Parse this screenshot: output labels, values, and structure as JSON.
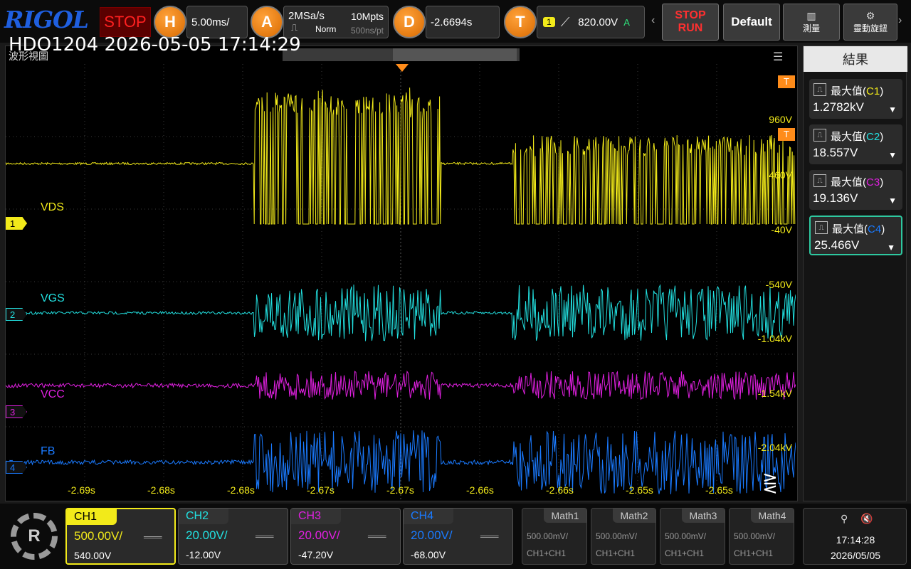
{
  "brand": "RIGOL",
  "run_state": "STOP",
  "horizontal": {
    "key": "H",
    "scale": "5.00ms/"
  },
  "acquire": {
    "key": "A",
    "rate": "2MSa/s",
    "depth": "10Mpts",
    "mode": "Norm",
    "res": "500ns/pt"
  },
  "delay": {
    "key": "D",
    "value": "-2.6694s"
  },
  "trigger": {
    "key": "T",
    "source": "1",
    "level": "820.00V",
    "mode": "A"
  },
  "buttons": {
    "stop_run_1": "STOP",
    "stop_run_2": "RUN",
    "default": "Default",
    "measure": "測量",
    "quick": "靈動旋鈕"
  },
  "overlay_text": "HDO1204 2026-05-05 17:14:29",
  "waveform_title": "波形視圖",
  "time_ticks": [
    "-2.69s",
    "-2.68s",
    "-2.68s",
    "-2.67s",
    "-2.67s",
    "-2.66s",
    "-2.66s",
    "-2.65s",
    "-2.65s"
  ],
  "volt_ticks": [
    "960V",
    "460V",
    "-40V",
    "-540V",
    "-1.04kV",
    "-1.54kV",
    "-2.04kV"
  ],
  "channel_labels": [
    {
      "num": "1",
      "name": "VDS",
      "color": "#f2ea1a"
    },
    {
      "num": "2",
      "name": "VGS",
      "color": "#22e0e0"
    },
    {
      "num": "3",
      "name": "VCC",
      "color": "#e020e0"
    },
    {
      "num": "4",
      "name": "FB",
      "color": "#1a7aff"
    }
  ],
  "results": {
    "title": "結果",
    "items": [
      {
        "label": "最大值",
        "src": "C1",
        "value": "1.2782kV",
        "color": "#f2ea1a"
      },
      {
        "label": "最大值",
        "src": "C2",
        "value": "18.557V",
        "color": "#22e0e0"
      },
      {
        "label": "最大值",
        "src": "C3",
        "value": "19.136V",
        "color": "#e020e0"
      },
      {
        "label": "最大值",
        "src": "C4",
        "value": "25.466V",
        "color": "#1a7aff"
      }
    ]
  },
  "channels": [
    {
      "name": "CH1",
      "scale": "500.00V/",
      "offset": "540.00V",
      "color": "#f2ea1a"
    },
    {
      "name": "CH2",
      "scale": "20.00V/",
      "offset": "-12.00V",
      "color": "#22e0e0"
    },
    {
      "name": "CH3",
      "scale": "20.00V/",
      "offset": "-47.20V",
      "color": "#e020e0"
    },
    {
      "name": "CH4",
      "scale": "20.00V/",
      "offset": "-68.00V",
      "color": "#1a7aff"
    }
  ],
  "maths": [
    {
      "name": "Math1",
      "scale": "500.00mV/",
      "expr": "CH1+CH1"
    },
    {
      "name": "Math2",
      "scale": "500.00mV/",
      "expr": "CH1+CH1"
    },
    {
      "name": "Math3",
      "scale": "500.00mV/",
      "expr": "CH1+CH1"
    },
    {
      "name": "Math4",
      "scale": "500.00mV/",
      "expr": "CH1+CH1"
    }
  ],
  "clock": {
    "time": "17:14:28",
    "date": "2026/05/05"
  }
}
